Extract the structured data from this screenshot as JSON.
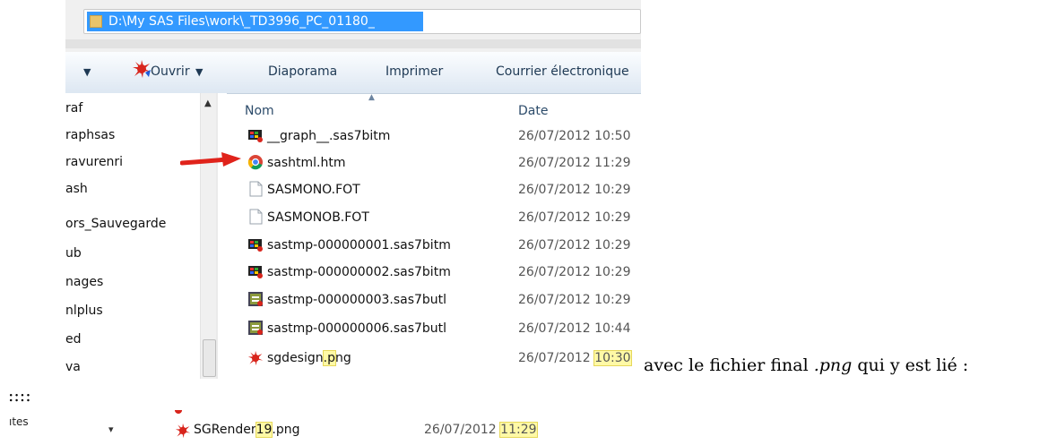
{
  "explorer": {
    "address_path": "D:\\My SAS Files\\work\\_TD3996_PC_01180_",
    "toolbar": {
      "open_label": "Ouvrir",
      "slideshow_label": "Diaporama",
      "print_label": "Imprimer",
      "email_label": "Courrier électronique"
    },
    "nav_items": [
      "raf",
      "raphsas",
      "ravurenri",
      "ash",
      "ors_Sauvegarde",
      "ub",
      "nages",
      "nlplus",
      "ed",
      "va"
    ],
    "columns": {
      "name": "Nom",
      "date": "Date"
    },
    "files": [
      {
        "name": "__graph__.sas7bitm",
        "date": "26/07/2012 10:50",
        "icon": "sas-bitmap-icon"
      },
      {
        "name": "sashtml.htm",
        "date": "26/07/2012 11:29",
        "icon": "chrome-html-icon"
      },
      {
        "name": "SASMONO.FOT",
        "date": "26/07/2012 10:29",
        "icon": "blank-file-icon"
      },
      {
        "name": "SASMONOB.FOT",
        "date": "26/07/2012 10:29",
        "icon": "blank-file-icon"
      },
      {
        "name": "sastmp-000000001.sas7bitm",
        "date": "26/07/2012 10:29",
        "icon": "sas-bitmap-icon"
      },
      {
        "name": "sastmp-000000002.sas7bitm",
        "date": "26/07/2012 10:29",
        "icon": "sas-bitmap-icon"
      },
      {
        "name": "sastmp-000000003.sas7butl",
        "date": "26/07/2012 10:29",
        "icon": "sas-utility-icon"
      },
      {
        "name": "sastmp-000000006.sas7butl",
        "date": "26/07/2012 10:44",
        "icon": "sas-utility-icon"
      }
    ],
    "last_file": {
      "name_a": "sgdesign",
      "name_b": ".p",
      "name_c": "ng",
      "date_a": "26/07/2012 ",
      "date_b": "10:30"
    }
  },
  "caption": {
    "before": "avec le fichier final ",
    "ext": ".png",
    "after": " qui y est lié :"
  },
  "colons": "::::",
  "second": {
    "nav_fragment": "ıtes",
    "file_a": "SGRender",
    "file_b": "19",
    "file_c": ".png",
    "date_a": "26/07/2012 ",
    "date_b": "11:29"
  },
  "colors": {
    "selection": "#3399ff",
    "highlight": "#fff9a6",
    "arrow": "#e0231b"
  }
}
